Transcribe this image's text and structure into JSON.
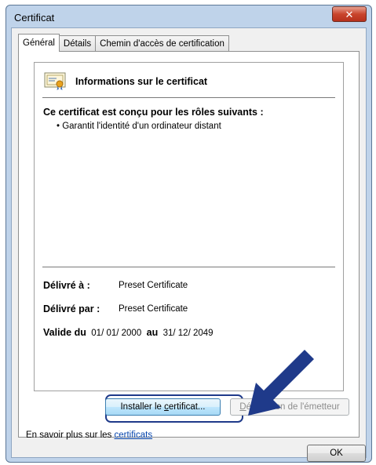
{
  "window": {
    "title": "Certificat"
  },
  "tabs": [
    {
      "label": "Général",
      "active": true
    },
    {
      "label": "Détails",
      "active": false
    },
    {
      "label": "Chemin d'accès de certification",
      "active": false
    }
  ],
  "info": {
    "title": "Informations sur le certificat",
    "roles_title": "Ce certificat est conçu pour les rôles suivants :",
    "roles": [
      "• Garantit l'identité d'un ordinateur distant"
    ],
    "issued_to_label": "Délivré à :",
    "issued_to_value": "Preset Certificate",
    "issued_by_label": "Délivré par :",
    "issued_by_value": "Preset Certificate",
    "valid_from_label": "Valide du",
    "valid_from_value": "01/ 01/ 2000",
    "valid_to_label": "au",
    "valid_to_value": "31/ 12/ 2049"
  },
  "buttons": {
    "install_pre": "Installer le ",
    "install_accel": "c",
    "install_post": "ertificat...",
    "declaration_accel": "D",
    "declaration_post": "éclaration de l'émetteur",
    "ok": "OK"
  },
  "learn_more": {
    "prefix": "En savoir plus sur les ",
    "link": "certificats"
  },
  "colors": {
    "highlight": "#1f3a8a",
    "arrow": "#1f3a8a",
    "close_button": "#c9452c"
  },
  "icons": [
    "certificate-icon",
    "close-icon",
    "pointer-arrow-icon"
  ]
}
